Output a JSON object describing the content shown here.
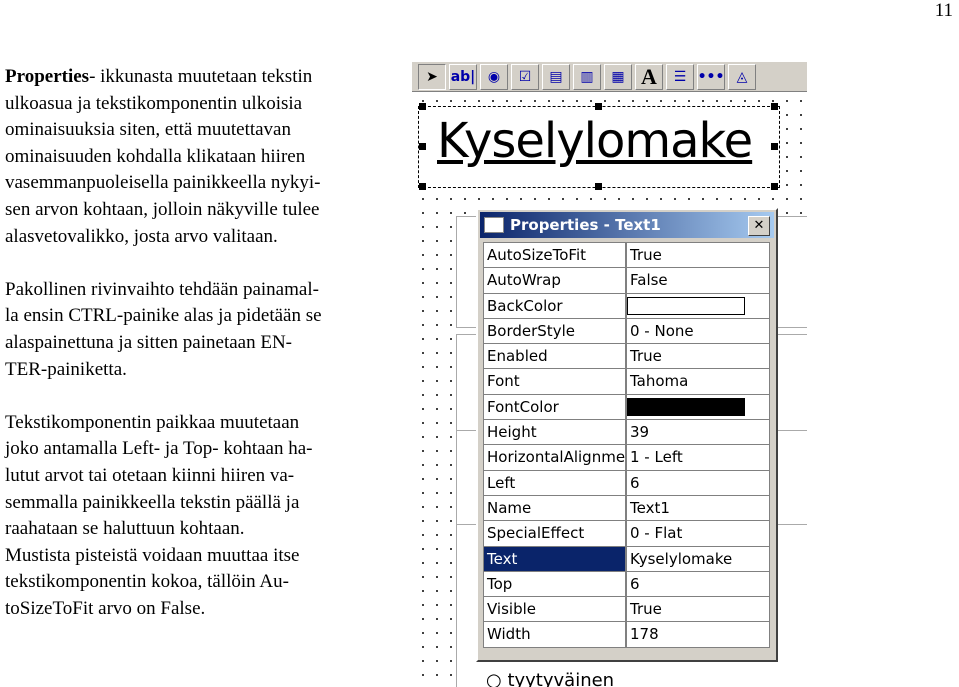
{
  "page_number": "11",
  "paragraphs": [
    {
      "lines": [
        "Properties- ikkunasta muutetaan tekstin",
        "ulkoasua ja tekstikomponentin ulkoisia",
        "ominaisuuksia siten, että muutettavan",
        "ominaisuuden kohdalla klikataan hiiren",
        "vasemmanpuoleisella painikkeella nykyi-",
        "sen arvon kohtaan, jolloin näkyville tulee",
        "alasvetovalikko, josta arvo valitaan."
      ]
    },
    {
      "lines": [
        "Pakollinen rivinvaihto tehdään painamal-",
        "la ensin CTRL-painike alas ja pidetään se",
        "alaspainettuna ja sitten painetaan EN-",
        "TER-painiketta."
      ]
    },
    {
      "lines": [
        "Tekstikomponentin paikkaa muutetaan",
        "joko antamalla Left- ja Top- kohtaan ha-",
        "lutut arvot tai otetaan kiinni hiiren va-",
        "semmalla painikkeella tekstin päällä ja",
        "raahataan se haluttuun kohtaan.",
        "Mustista pisteistä voidaan muuttaa itse",
        "tekstikomponentin kokoa, tällöin  Au-",
        "toSizeToFit arvo on False."
      ]
    }
  ],
  "screenshot": {
    "toolbar": [
      {
        "icon": "pointer-icon",
        "glyph": "➤"
      },
      {
        "icon": "textbox-icon",
        "glyph": "ab|"
      },
      {
        "icon": "option-button-icon",
        "glyph": "◉"
      },
      {
        "icon": "checkbox-icon",
        "glyph": "☑"
      },
      {
        "icon": "listbox-icon",
        "glyph": "▤"
      },
      {
        "icon": "combobox-icon",
        "glyph": "▥"
      },
      {
        "icon": "table-icon",
        "glyph": "▦"
      },
      {
        "icon": "label-icon",
        "glyph": "A"
      },
      {
        "icon": "numbered-list-icon",
        "glyph": "☰"
      },
      {
        "icon": "more-icon",
        "glyph": "•••"
      },
      {
        "icon": "image-icon",
        "glyph": "◬"
      }
    ],
    "label_text": "Kyselylomake",
    "bottom_text": "tyytyväinen",
    "properties": {
      "title": "Properties - Text1",
      "close": "✕",
      "rows": [
        {
          "name": "AutoSizeToFit",
          "value": "True"
        },
        {
          "name": "AutoWrap",
          "value": "False"
        },
        {
          "name": "BackColor",
          "value": "",
          "swatch": "#ffffff"
        },
        {
          "name": "BorderStyle",
          "value": "0 - None"
        },
        {
          "name": "Enabled",
          "value": "True"
        },
        {
          "name": "Font",
          "value": "Tahoma"
        },
        {
          "name": "FontColor",
          "value": "",
          "swatch": "#000000"
        },
        {
          "name": "Height",
          "value": "39"
        },
        {
          "name": "HorizontalAlignment",
          "value": "1 - Left"
        },
        {
          "name": "Left",
          "value": "6"
        },
        {
          "name": "Name",
          "value": "Text1"
        },
        {
          "name": "SpecialEffect",
          "value": "0 - Flat"
        },
        {
          "name": "Text",
          "value": "Kyselylomake",
          "selected": true
        },
        {
          "name": "Top",
          "value": "6"
        },
        {
          "name": "Visible",
          "value": "True"
        },
        {
          "name": "Width",
          "value": "178"
        }
      ]
    }
  }
}
